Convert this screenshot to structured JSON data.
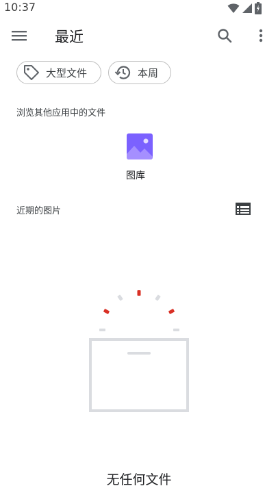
{
  "status_bar": {
    "time": "10:37"
  },
  "app_bar": {
    "menu_icon": "menu-icon",
    "title": "最近",
    "search_icon": "search-icon",
    "more_icon": "more-vert-icon"
  },
  "filters": [
    {
      "label": "大型文件",
      "icon": "tag-icon"
    },
    {
      "label": "本周",
      "icon": "history-icon"
    }
  ],
  "browse_section": {
    "heading": "浏览其他应用中的文件",
    "apps": [
      {
        "label": "图库",
        "icon": "gallery-icon"
      }
    ]
  },
  "recent_section": {
    "heading": "近期的图片",
    "view_toggle_icon": "list-view-icon"
  },
  "empty_state": {
    "message": "无任何文件"
  },
  "colors": {
    "accent_red": "#d93025",
    "gallery_purple": "#7b61ff"
  }
}
